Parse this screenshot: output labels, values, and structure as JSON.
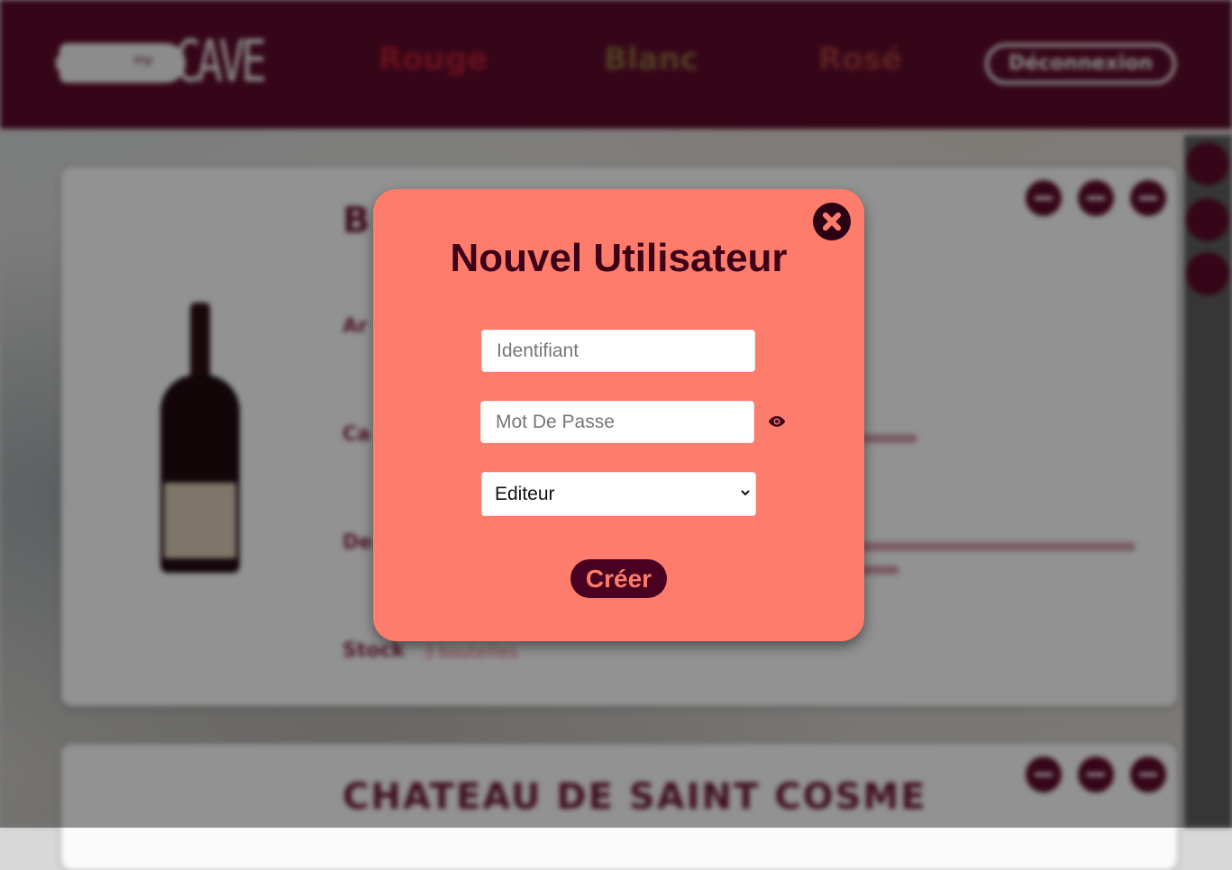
{
  "header": {
    "logo_small": "my",
    "logo_big": "CAVE",
    "nav": [
      "Rouge",
      "Blanc",
      "Rosé"
    ],
    "logout_label": "Déconnexion"
  },
  "cards": [
    {
      "title": "B",
      "labels": [
        "Ar",
        "Ca",
        "De",
        "Stock"
      ],
      "stock_value": "3 bouteilles"
    },
    {
      "title": "CHATEAU DE SAINT COSME"
    }
  ],
  "modal": {
    "title": "Nouvel Utilisateur",
    "username_placeholder": "Identifiant",
    "password_placeholder": "Mot De Passe",
    "role_selected": "Editeur",
    "create_label": "Créer"
  },
  "colors": {
    "modal_bg": "#fe7c6b",
    "dark_wine": "#3d0018",
    "header_bg": "#5c0a2a"
  },
  "icons": [
    "close-icon",
    "eye-icon",
    "chevron-down-icon"
  ]
}
